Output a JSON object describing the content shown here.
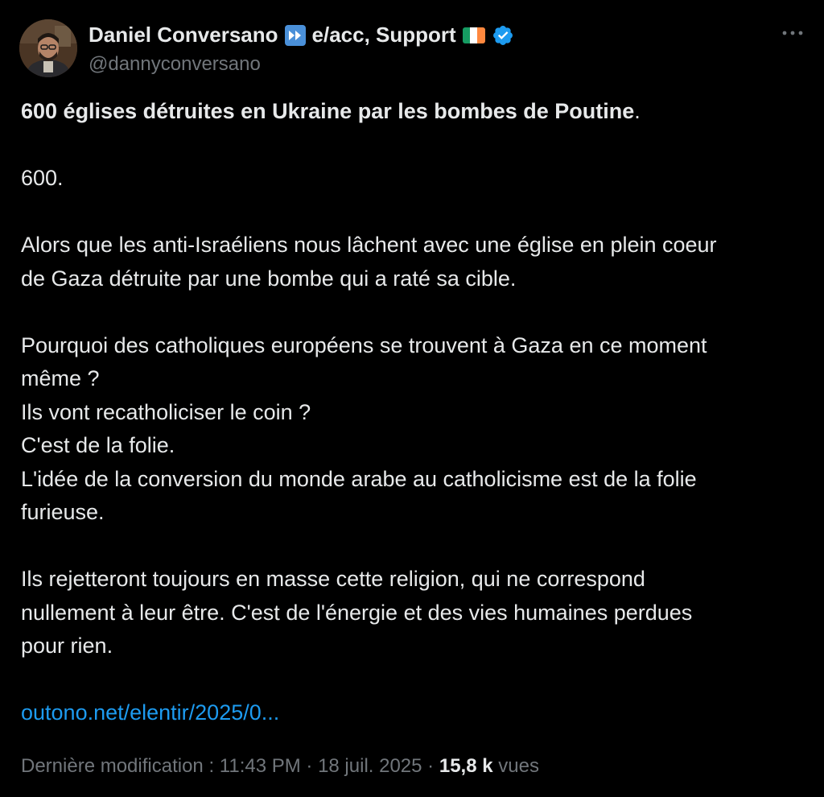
{
  "author": {
    "display_name": "Daniel Conversano",
    "tagline": "e/acc, Support",
    "handle": "@dannyconversano",
    "verified": true,
    "icons": [
      "fast-forward-icon",
      "ireland-flag-icon",
      "verified-badge-icon"
    ]
  },
  "menu": {
    "icon": "more-icon"
  },
  "tweet": {
    "headline": "600 églises détruites en Ukraine par les bombes de Poutine",
    "headline_period": ".",
    "line_600": "600.",
    "para2_line1": "Alors que les anti-Israéliens nous lâchent avec une église en plein coeur",
    "para2_line2": "de Gaza détruite par une bombe qui a raté sa cible.",
    "para3_line1": "Pourquoi des catholiques européens se trouvent à Gaza en ce moment",
    "para3_line2": "même ?",
    "para3_line3": "Ils vont recatholiciser le coin ?",
    "para3_line4": "C'est de la folie.",
    "para3_line5": "L'idée de la conversion du monde arabe au catholicisme est de la folie",
    "para3_line6": "furieuse.",
    "para4_line1": "Ils rejetteront toujours en masse cette religion, qui ne correspond",
    "para4_line2": "nullement à leur être. C'est de l'énergie et des vies humaines perdues",
    "para4_line3": "pour rien.",
    "link": "outono.net/elentir/2025/0..."
  },
  "meta": {
    "edited_label": "Dernière modification : 11:43 PM",
    "separator": "·",
    "date": "18 juil. 2025",
    "views_count": "15,8 k",
    "views_label": "vues"
  },
  "colors": {
    "background": "#000000",
    "text": "#e7e9ea",
    "secondary": "#71767b",
    "link": "#1d9bf0",
    "verified": "#1d9bf0"
  }
}
